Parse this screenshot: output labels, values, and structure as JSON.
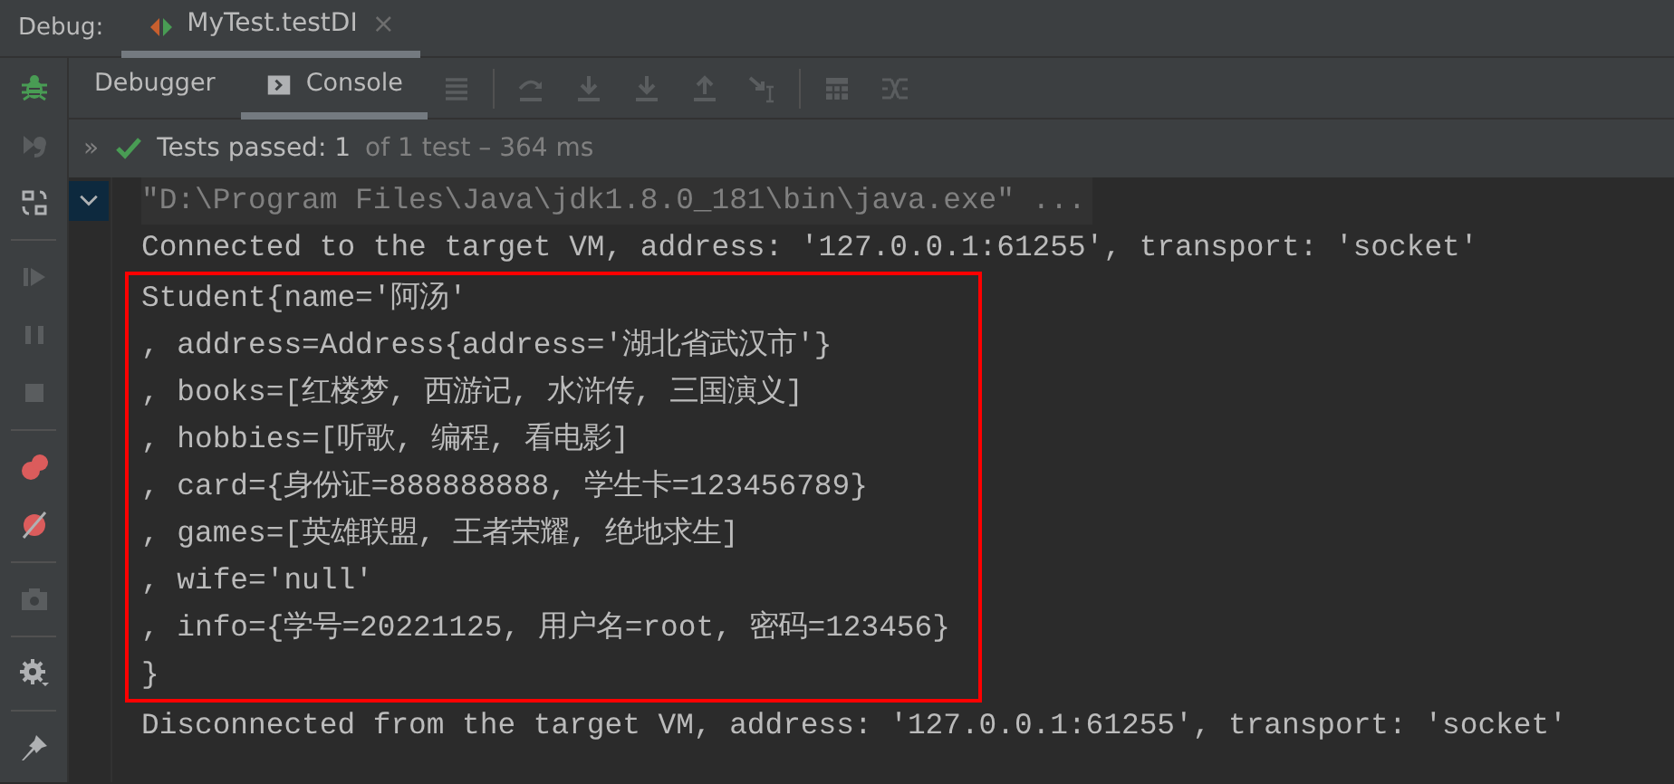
{
  "header": {
    "label": "Debug:",
    "tabs": [
      {
        "label": "MyTest.testDI",
        "selected": true,
        "close": "×"
      }
    ]
  },
  "tool_tabs": [
    {
      "label": "Debugger",
      "selected": false,
      "icon": false
    },
    {
      "label": "Console",
      "selected": true,
      "icon": true
    }
  ],
  "test_status": {
    "expand": "»",
    "passed": "Tests passed: 1",
    "detail": "of 1 test – 364 ms"
  },
  "console": {
    "blocks": [
      {
        "kind": "plain",
        "lines": [
          {
            "kind": "command",
            "text": "\"D:\\Program Files\\Java\\jdk1.8.0_181\\bin\\java.exe\" ..."
          },
          {
            "kind": "output",
            "text": "Connected to the target VM, address: '127.0.0.1:61255', transport: 'socket'"
          }
        ]
      },
      {
        "kind": "highlighted",
        "lines": [
          {
            "kind": "output",
            "text": "Student{name='阿汤'"
          },
          {
            "kind": "output",
            "text": ", address=Address{address='湖北省武汉市'}"
          },
          {
            "kind": "output",
            "text": ", books=[红楼梦, 西游记, 水浒传, 三国演义]"
          },
          {
            "kind": "output",
            "text": ", hobbies=[听歌, 编程, 看电影]"
          },
          {
            "kind": "output",
            "text": ", card={身份证=888888888, 学生卡=123456789}"
          },
          {
            "kind": "output",
            "text": ", games=[英雄联盟, 王者荣耀, 绝地求生]"
          },
          {
            "kind": "output",
            "text": ", wife='null'"
          },
          {
            "kind": "output",
            "text": ", info={学号=20221125, 用户名=root, 密码=123456}"
          },
          {
            "kind": "output",
            "text": "}"
          }
        ]
      },
      {
        "kind": "plain",
        "lines": [
          {
            "kind": "output",
            "text": "Disconnected from the target VM, address: '127.0.0.1:61255', transport: 'socket'"
          }
        ]
      }
    ]
  }
}
